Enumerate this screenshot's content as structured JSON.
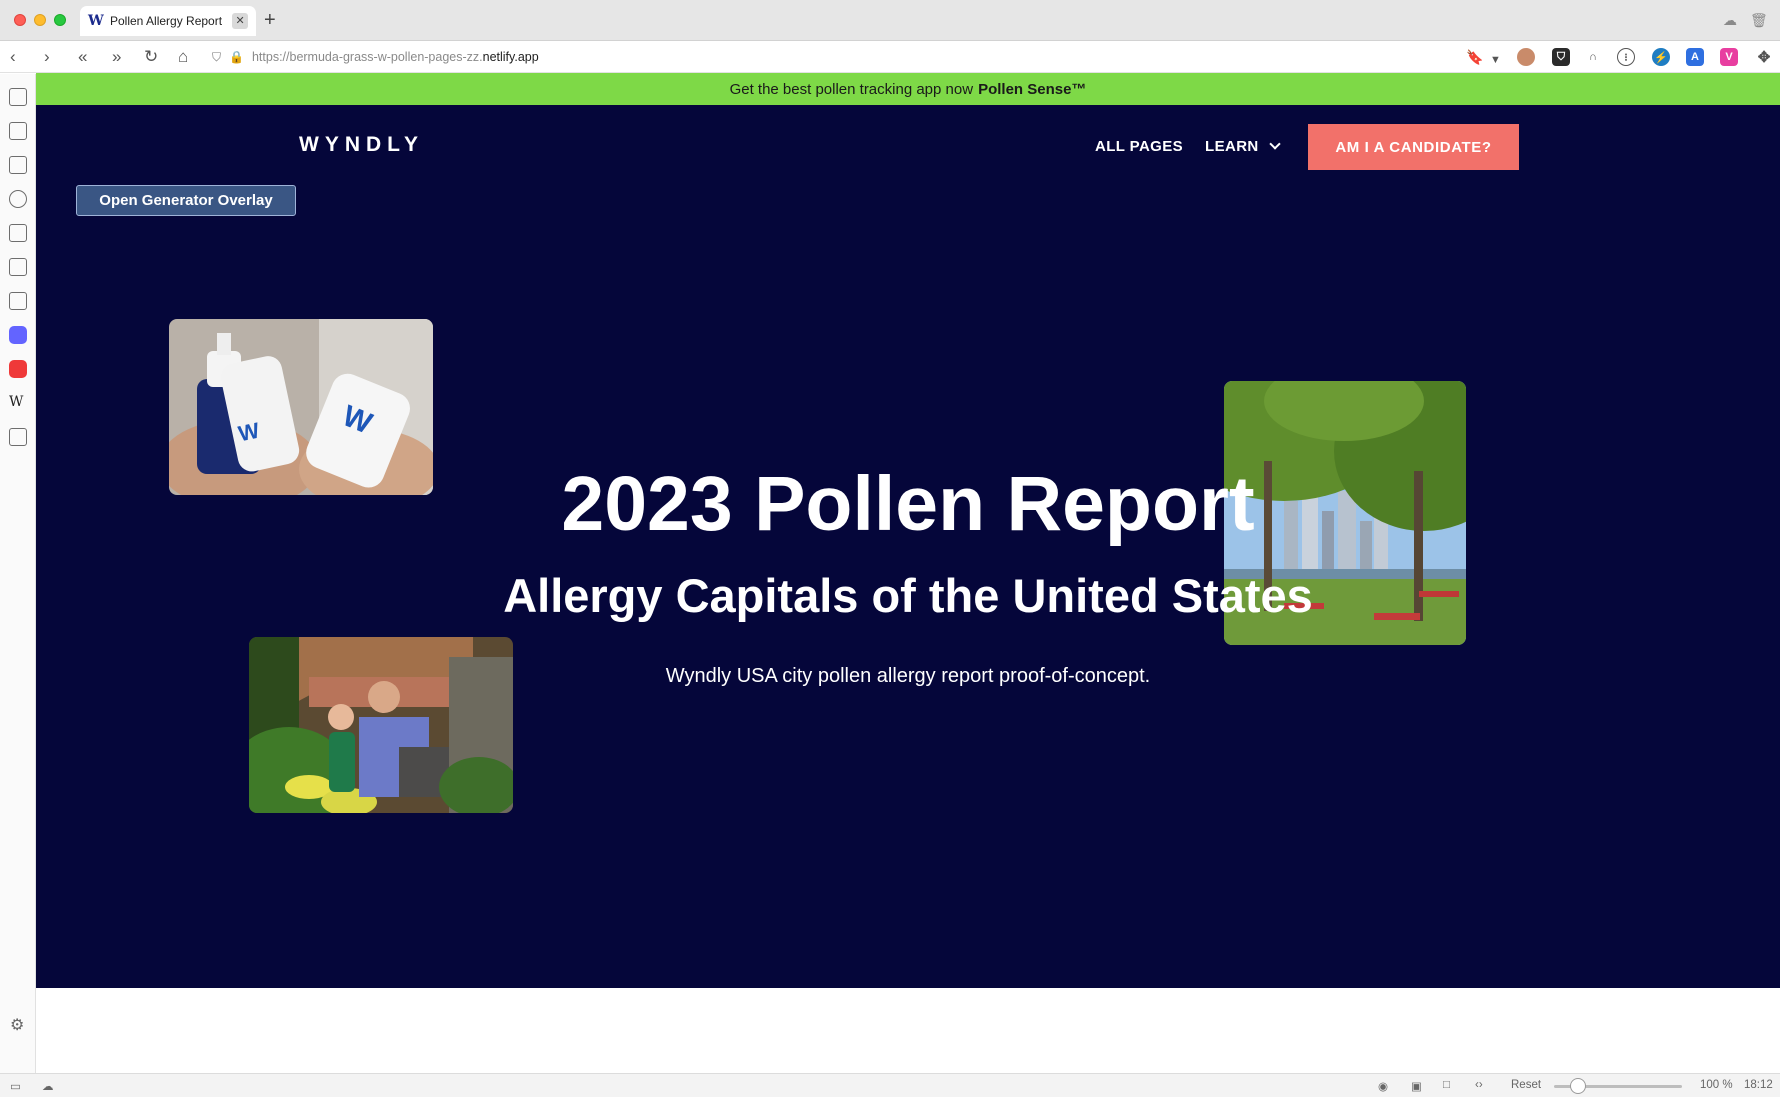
{
  "browser": {
    "tab_title": "Pollen Allergy Report",
    "tab_close": "✕",
    "new_tab": "+",
    "url_prefix": "https://bermuda-grass-w-pollen-pages-zz.",
    "url_domain": "netlify.app"
  },
  "promo": {
    "text": "Get the best pollen tracking app now",
    "link": "Pollen Sense™"
  },
  "header": {
    "logo": "WYNDLY",
    "nav": [
      "ALL PAGES",
      "LEARN"
    ],
    "cta": "AM I A CANDIDATE?"
  },
  "overlay_button": "Open Generator Overlay",
  "hero": {
    "title": "2023 Pollen Report",
    "subtitle": "Allergy Capitals of the United States",
    "description": "Wyndly USA city pollen allergy report proof-of-concept."
  },
  "status": {
    "reset": "Reset",
    "zoom": "100 %",
    "time": "18:12"
  },
  "colors": {
    "hero_bg": "#05063a",
    "promo_bg": "#7ed947",
    "cta_bg": "#f2716a",
    "overlay_btn_bg": "#3a5684"
  }
}
